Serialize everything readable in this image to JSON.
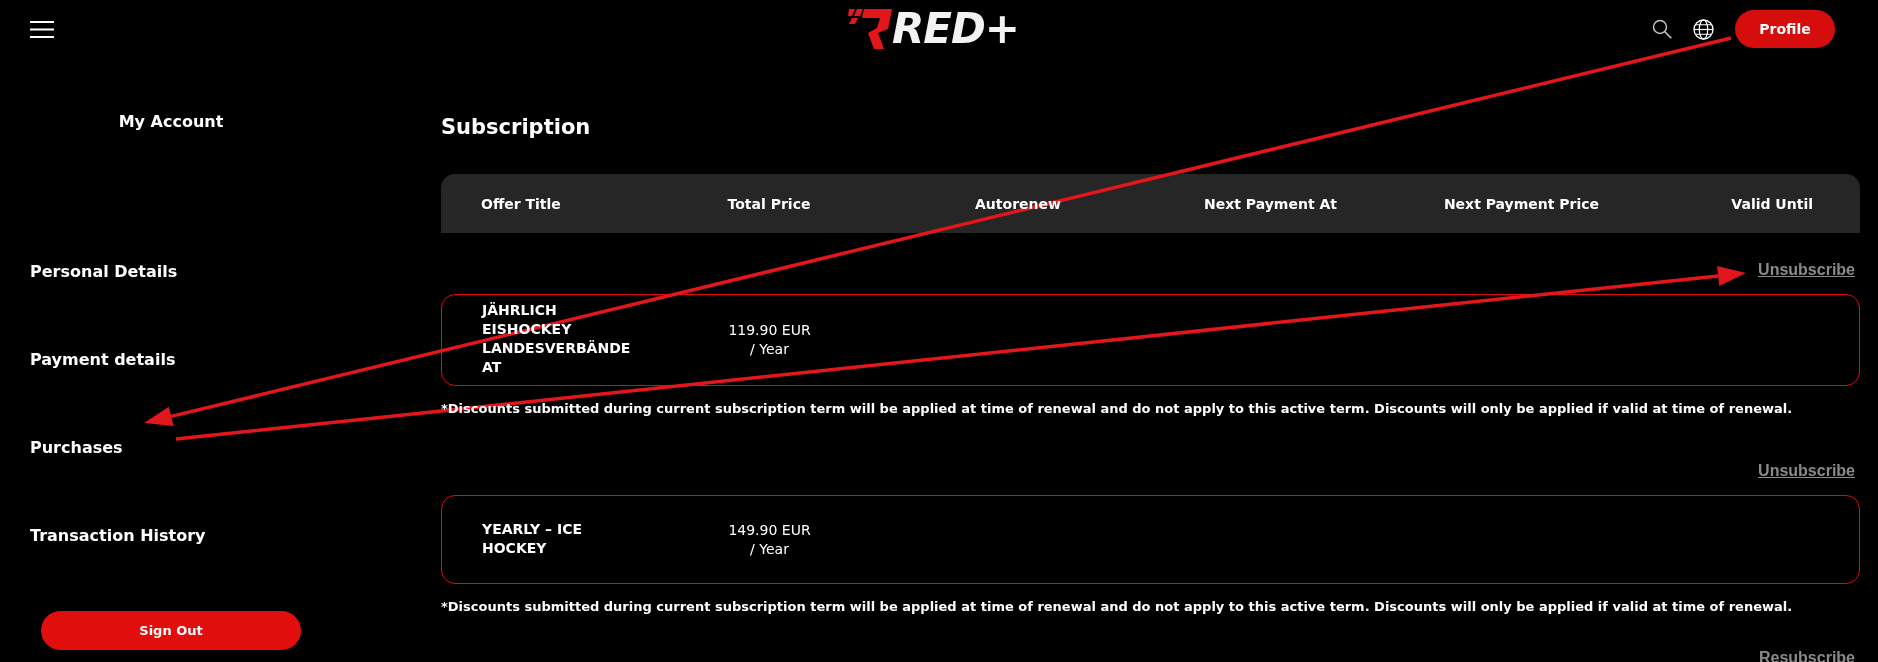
{
  "header": {
    "logo": "RED+",
    "profile_button": "Profile"
  },
  "sidebar": {
    "title": "My Account",
    "items": [
      "Personal Details",
      "Payment details",
      "Purchases",
      "Transaction History"
    ],
    "sign_out": "Sign Out"
  },
  "main": {
    "title": "Subscription",
    "columns": [
      "Offer Title",
      "Total Price",
      "Autorenew",
      "Next Payment At",
      "Next Payment Price",
      "Valid Until"
    ],
    "subscriptions": [
      {
        "action": "Unsubscribe",
        "offer_title": "JÄHRLICH EISHOCKEY LANDESVERBÄNDE AT",
        "total_price": "119.90 EUR",
        "billing_period": "/ Year",
        "note": "*Discounts submitted during current subscription term will be applied at time of renewal and do not apply to this active term. Discounts will only be applied if valid at time of renewal."
      },
      {
        "action": "Unsubscribe",
        "offer_title": "YEARLY – ICE HOCKEY",
        "total_price": "149.90 EUR",
        "billing_period": "/ Year",
        "note": "*Discounts submitted during current subscription term will be applied at time of renewal and do not apply to this active term. Discounts will only be applied if valid at time of renewal."
      },
      {
        "action": "Resubscribe"
      }
    ]
  }
}
